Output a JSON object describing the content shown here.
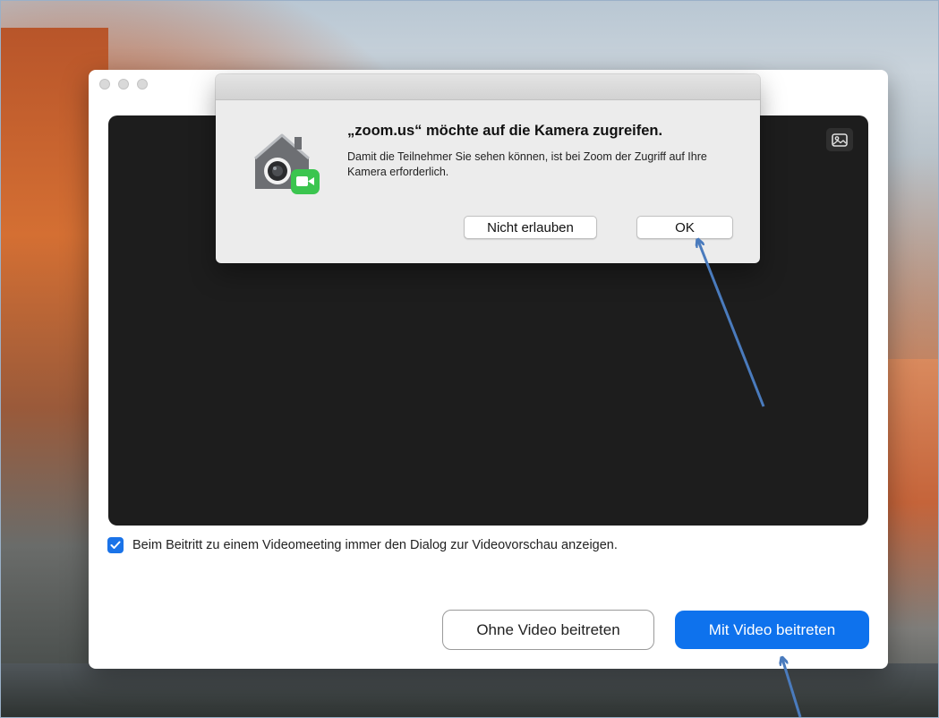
{
  "alert": {
    "title": "„zoom.us“ möchte auf die Kamera zugreifen.",
    "message": "Damit die Teilnehmer Sie sehen können, ist bei Zoom der Zugriff auf Ihre Kamera erforderlich.",
    "deny_label": "Nicht erlauben",
    "ok_label": "OK",
    "icon": "security-camera-icon"
  },
  "preview": {
    "background_icon": "virtual-background-icon",
    "checkbox_checked": true,
    "checkbox_label": "Beim Beitritt zu einem Videomeeting immer den Dialog zur Videovorschau anzeigen."
  },
  "actions": {
    "join_without_video": "Ohne Video beitreten",
    "join_with_video": "Mit Video beitreten"
  },
  "colors": {
    "primary": "#0e72ed",
    "checkbox": "#1a73e8",
    "annotation_arrow": "#4a7bbd",
    "preview_bg": "#1d1d1d"
  }
}
